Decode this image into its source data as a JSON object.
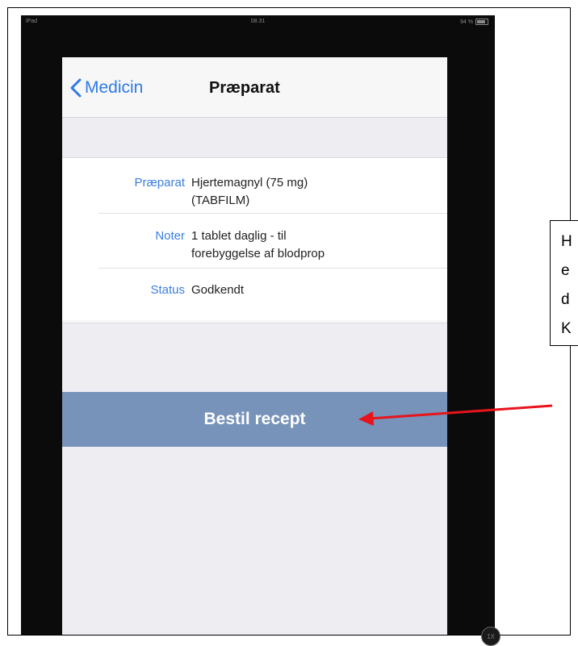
{
  "statusbar": {
    "device": "iPad",
    "time": "08.31",
    "battery": "94 %"
  },
  "navbar": {
    "back_label": "Medicin",
    "title": "Præparat"
  },
  "details": [
    {
      "label": "Præparat",
      "value_line1": "Hjertemagnyl (75 mg)",
      "value_line2": "(TABFILM)"
    },
    {
      "label": "Noter",
      "value_line1": "1 tablet daglig - til",
      "value_line2": "forebyggelse af blodprop"
    },
    {
      "label": "Status",
      "value_line1": "Godkendt",
      "value_line2": ""
    }
  ],
  "order_button_label": "Bestil recept",
  "zoom_label": "1X",
  "callout": {
    "lines": [
      "H",
      "e",
      "d",
      "K"
    ]
  },
  "colors": {
    "accent": "#2f7ae5",
    "button_bg": "#7793b9",
    "arrow": "#e8141b"
  }
}
